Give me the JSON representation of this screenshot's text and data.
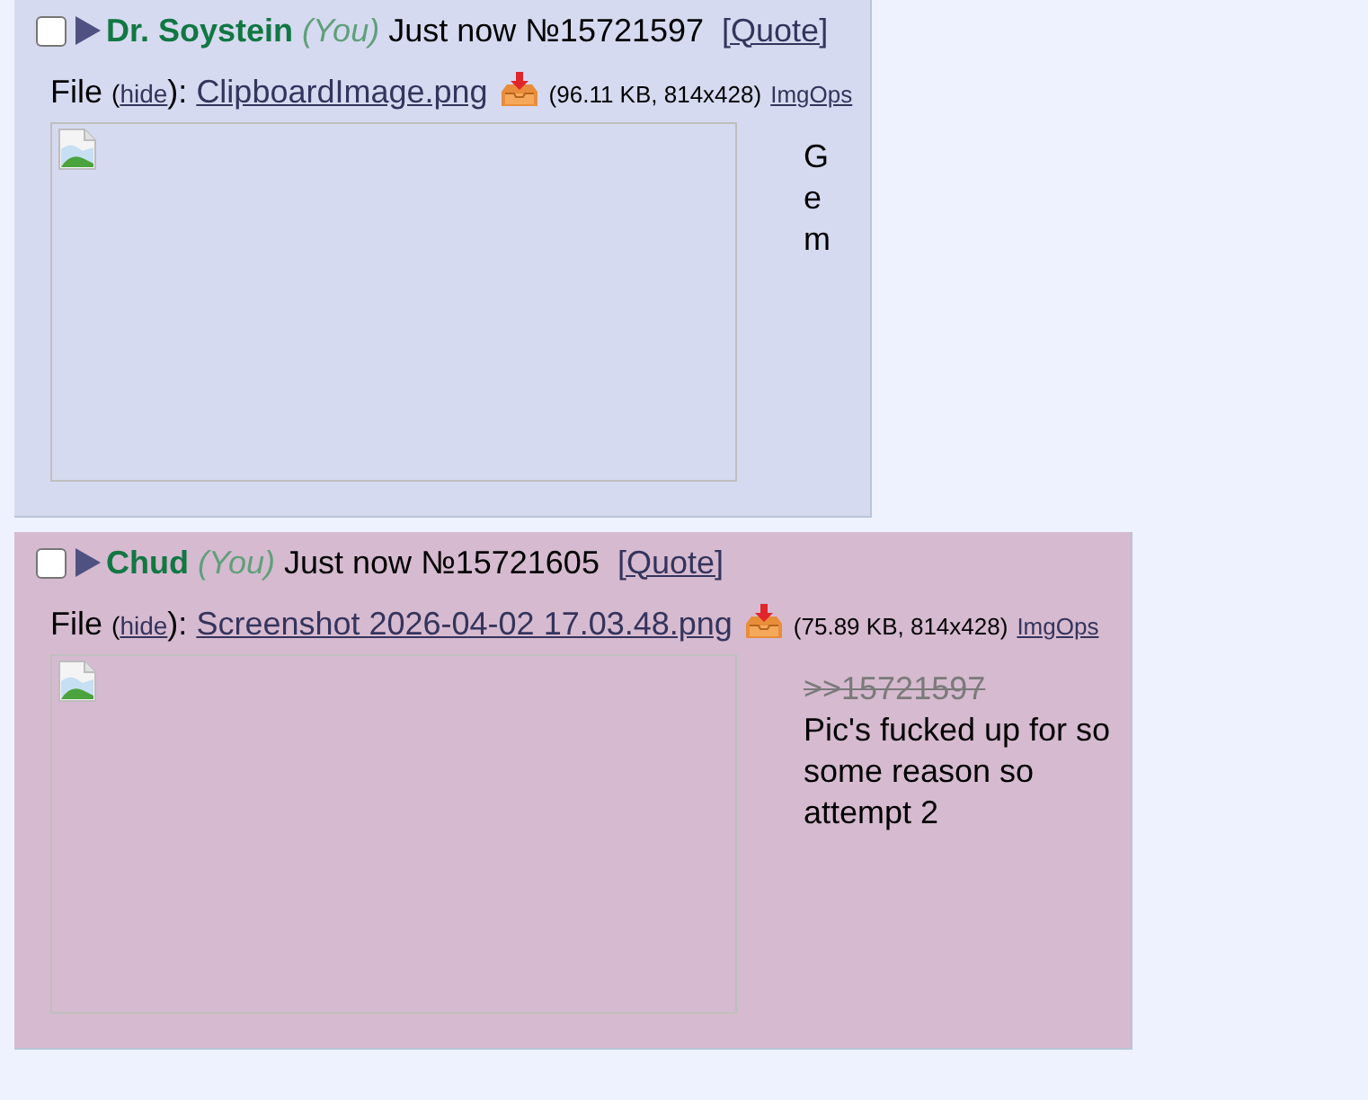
{
  "posts": [
    {
      "highlighted": false,
      "checked": false,
      "name": "Dr. Soystein",
      "you": "(You)",
      "time": "Just now",
      "number": "№15721597",
      "quote_link": "[Quote]",
      "file": {
        "label": "File",
        "paren_open": "(",
        "hide_link": "hide",
        "paren_close": "):",
        "filename": "ClipboardImage.png",
        "info": "(96.11 KB, 814x428)",
        "imgops": "ImgOps"
      },
      "message": {
        "lines": [
          "G",
          "e",
          "m"
        ]
      }
    },
    {
      "highlighted": true,
      "checked": false,
      "name": "Chud",
      "you": "(You)",
      "time": "Just now",
      "number": "№15721605",
      "quote_link": "[Quote]",
      "file": {
        "label": "File",
        "paren_open": "(",
        "hide_link": "hide",
        "paren_close": "):",
        "filename": "Screenshot 2026-04-02 17.03.48.png",
        "info": "(75.89 KB, 814x428)",
        "imgops": "ImgOps"
      },
      "message": {
        "quote": {
          "text": ">>15721597",
          "dead": true
        },
        "lines": [
          "Pic's fucked up for so some reason so attempt 2"
        ]
      }
    }
  ]
}
